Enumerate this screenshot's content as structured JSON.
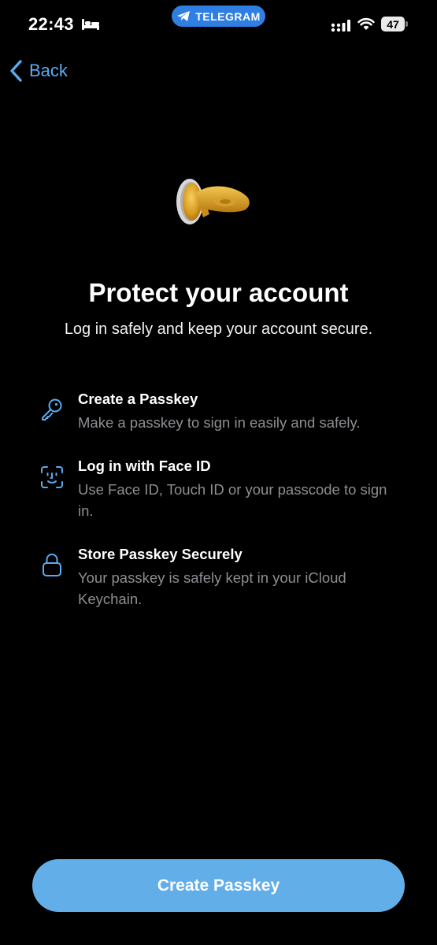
{
  "status_bar": {
    "time": "22:43",
    "app_pill": "TELEGRAM",
    "battery": "47"
  },
  "nav": {
    "back_label": "Back"
  },
  "hero": {
    "icon": "key-emoji",
    "title": "Protect your account",
    "subtitle": "Log in safely and keep your account secure."
  },
  "features": [
    {
      "icon": "key-icon",
      "title": "Create a Passkey",
      "description": "Make a passkey to sign in easily and safely."
    },
    {
      "icon": "face-id-icon",
      "title": "Log in with Face ID",
      "description": "Use Face ID, Touch ID or your passcode to sign in."
    },
    {
      "icon": "lock-icon",
      "title": "Store Passkey Securely",
      "description": "Your passkey is safely kept in your iCloud Keychain."
    }
  ],
  "primary_button": {
    "label": "Create Passkey"
  },
  "colors": {
    "background": "#000000",
    "accent": "#5aabf0",
    "button": "#62aee9",
    "secondary_text": "#8e8e93",
    "status_pill": "#2f7fe2"
  }
}
